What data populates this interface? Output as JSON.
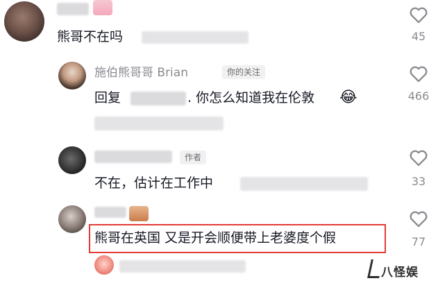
{
  "comments": [
    {
      "text": "熊哥不在吗",
      "likes": "45"
    },
    {
      "author": "施伯熊哥哥 Brian",
      "badge": "你的关注",
      "reply_prefix": "回复",
      "text": ". 你怎么知道我在伦敦",
      "emoji": "😂",
      "likes": "466"
    },
    {
      "badge": "作者",
      "text": "不在，估计在工作中",
      "likes": "33"
    },
    {
      "text": "熊哥在英国 又是开会顺便带上老婆度个假",
      "likes": "77"
    }
  ],
  "watermark": "八怪娱",
  "colors": {
    "highlight_border": "#e23b36",
    "muted_text": "#8a8b91",
    "main_text": "#161823"
  }
}
